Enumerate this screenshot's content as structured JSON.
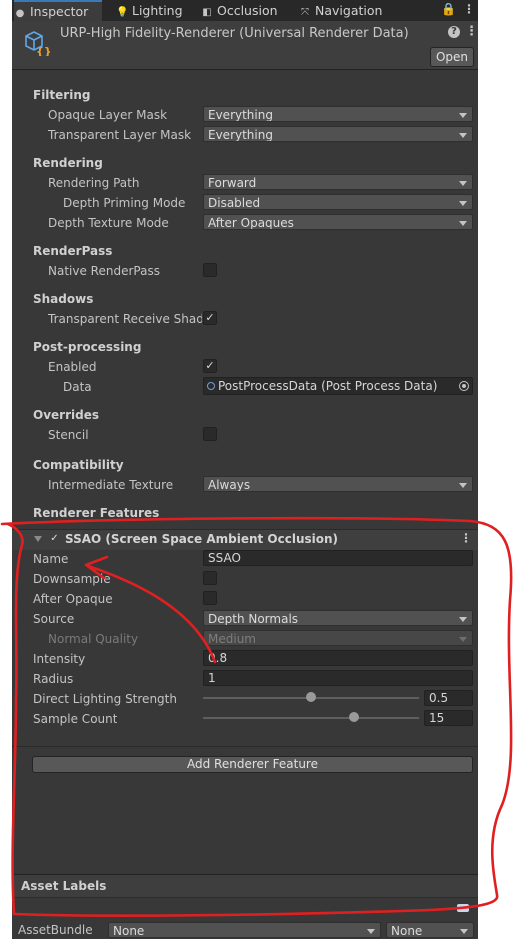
{
  "tabs": [
    {
      "label": "Inspector",
      "icon": "info-icon"
    },
    {
      "label": "Lighting",
      "icon": "bulb-icon"
    },
    {
      "label": "Occlusion",
      "icon": "occlusion-icon"
    },
    {
      "label": "Navigation",
      "icon": "navigation-icon"
    }
  ],
  "header": {
    "title": "URP-High Fidelity-Renderer (Universal Renderer Data)",
    "open_label": "Open",
    "help_glyph": "?",
    "menu_glyph": "⋮"
  },
  "filtering": {
    "title": "Filtering",
    "opaque_label": "Opaque Layer Mask",
    "opaque_value": "Everything",
    "transparent_label": "Transparent Layer Mask",
    "transparent_value": "Everything"
  },
  "rendering": {
    "title": "Rendering",
    "path_label": "Rendering Path",
    "path_value": "Forward",
    "priming_label": "Depth Priming Mode",
    "priming_value": "Disabled",
    "depth_texture_label": "Depth Texture Mode",
    "depth_texture_value": "After Opaques"
  },
  "renderpass": {
    "title": "RenderPass",
    "native_label": "Native RenderPass",
    "native_checked": false
  },
  "shadows": {
    "title": "Shadows",
    "transparent_receive_label": "Transparent Receive Shado",
    "transparent_receive_checked": true
  },
  "postprocessing": {
    "title": "Post-processing",
    "enabled_label": "Enabled",
    "enabled_checked": true,
    "data_label": "Data",
    "data_value": "PostProcessData (Post Process Data)"
  },
  "overrides": {
    "title": "Overrides",
    "stencil_label": "Stencil",
    "stencil_checked": false
  },
  "compatibility": {
    "title": "Compatibility",
    "intermediate_label": "Intermediate Texture",
    "intermediate_value": "Always"
  },
  "renderer_features": {
    "title": "Renderer Features",
    "feature_title": "SSAO (Screen Space Ambient Occlusion)",
    "feature_enabled": true,
    "name_label": "Name",
    "name_value": "SSAO",
    "downsample_label": "Downsample",
    "downsample_checked": false,
    "after_opaque_label": "After Opaque",
    "after_opaque_checked": false,
    "source_label": "Source",
    "source_value": "Depth Normals",
    "normal_quality_label": "Normal Quality",
    "normal_quality_value": "Medium",
    "intensity_label": "Intensity",
    "intensity_value": "0.8",
    "radius_label": "Radius",
    "radius_value": "1",
    "direct_lighting_label": "Direct Lighting Strength",
    "direct_lighting_value": "0.5",
    "direct_lighting_fraction": 0.5,
    "sample_count_label": "Sample Count",
    "sample_count_value": "15",
    "sample_count_fraction": 0.7,
    "add_button_label": "Add Renderer Feature"
  },
  "asset_labels": {
    "title": "Asset Labels",
    "bundle_label": "AssetBundle",
    "bundle_value": "None",
    "variant_value": "None"
  },
  "colors": {
    "panel": "#383838",
    "tab_accent": "#3a79bb",
    "annotation": "#e02020"
  }
}
